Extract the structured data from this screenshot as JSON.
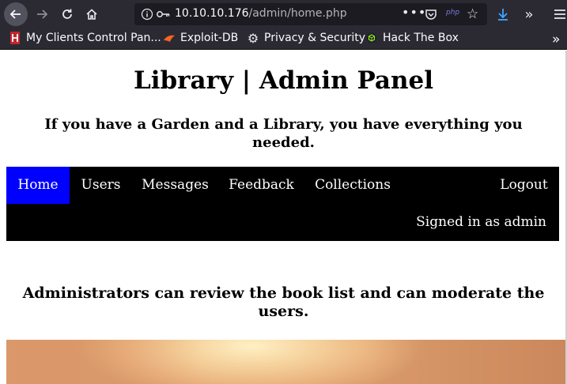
{
  "browser": {
    "url_host": "10.10.10.176",
    "url_path": "/admin/home.php",
    "php_badge": "php",
    "icons": [
      "back-arrow-icon",
      "forward-arrow-icon",
      "reload-icon",
      "home-icon",
      "info-icon",
      "key-icon",
      "more-dots-icon",
      "pocket-icon",
      "star-icon",
      "download-icon",
      "overflow-chevron-icon",
      "hamburger-menu-icon"
    ]
  },
  "bookmarks": [
    {
      "label": "My Clients Control Pan...",
      "icon": "red-bookmark-icon"
    },
    {
      "label": "Exploit-DB",
      "icon": "exploit-db-icon"
    },
    {
      "label": "Privacy & Security",
      "icon": "gear-icon"
    },
    {
      "label": "Hack The Box",
      "icon": "htb-cube-icon"
    }
  ],
  "page": {
    "title": "Library | Admin Panel",
    "subtitle": "If you have a Garden and a Library, you have everything you needed.",
    "nav": {
      "items": [
        "Home",
        "Users",
        "Messages",
        "Feedback",
        "Collections"
      ],
      "active": "Home",
      "logout": "Logout",
      "signed_in": "Signed in as admin"
    },
    "description": "Administrators can review the book list and can moderate the users."
  },
  "colors": {
    "toolbar_bg": "#2b2a33",
    "navbar_bg": "#000000",
    "nav_active_bg": "#0000ff",
    "page_bg": "#ffffff"
  }
}
